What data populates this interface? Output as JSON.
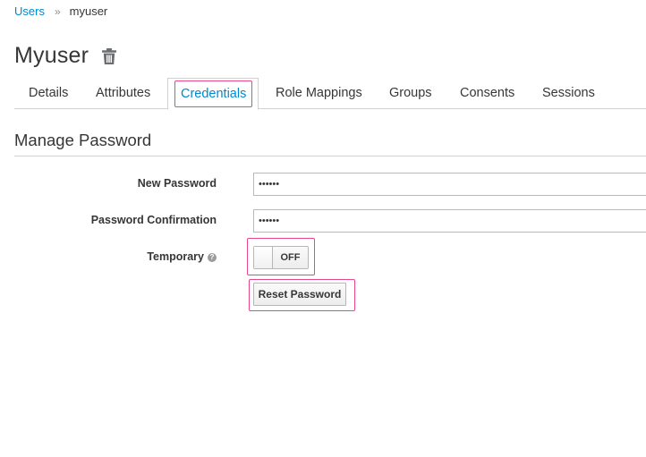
{
  "breadcrumb": {
    "parent": "Users",
    "separator": "»",
    "current": "myuser"
  },
  "header": {
    "title": "Myuser",
    "delete_icon": "trash-icon"
  },
  "tabs": [
    {
      "label": "Details",
      "active": false
    },
    {
      "label": "Attributes",
      "active": false
    },
    {
      "label": "Credentials",
      "active": true
    },
    {
      "label": "Role Mappings",
      "active": false
    },
    {
      "label": "Groups",
      "active": false
    },
    {
      "label": "Consents",
      "active": false
    },
    {
      "label": "Sessions",
      "active": false
    }
  ],
  "section": {
    "title": "Manage Password"
  },
  "form": {
    "new_password": {
      "label": "New Password",
      "value": "••••••"
    },
    "password_confirmation": {
      "label": "Password Confirmation",
      "value": "••••••"
    },
    "temporary": {
      "label": "Temporary",
      "help_icon": "question-circle-icon",
      "state": "OFF"
    },
    "reset_button": "Reset Password"
  },
  "colors": {
    "link": "#0088ce",
    "highlight": "#e8478b",
    "text": "#363636",
    "border": "#d1d1d1"
  }
}
